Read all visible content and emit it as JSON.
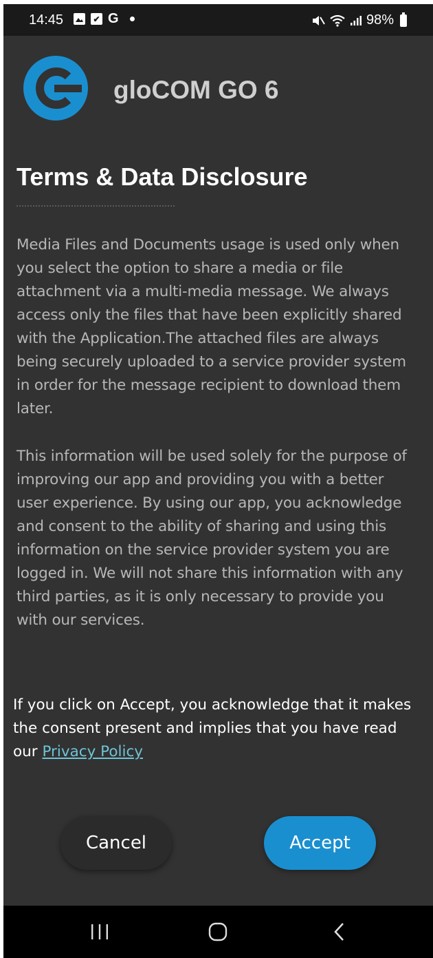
{
  "status_bar": {
    "time": "14:45",
    "battery": "98%",
    "icons_left": [
      "gallery-icon",
      "check-mail-icon",
      "google-icon",
      "dot-icon"
    ],
    "icons_right": [
      "mute-icon",
      "wifi-icon",
      "signal-icon",
      "battery-icon"
    ]
  },
  "header": {
    "app_name": "gloCOM GO 6",
    "page_title": "Terms & Data Disclosure",
    "logo_color": "#1a8fd0"
  },
  "body": {
    "paragraph_1": "Media Files and Documents usage is used only when you select the option to share a media or file attachment via a multi-media message. We always access only the files that have been explicitly shared with the Application.The attached files are always being securely uploaded to a service provider system in order for the message recipient to download them later.",
    "paragraph_2": "This information will be used solely for the purpose of improving our app and providing you with a better user experience. By using our app, you acknowledge and consent to the ability of sharing and using this information on the service provider system you are logged in. We will not share this information with any third parties, as it is only necessary to provide you with our services."
  },
  "consent": {
    "text": "If you click on Accept, you acknowledge that it makes the consent present and implies that you have read our ",
    "link_label": "Privacy Policy"
  },
  "actions": {
    "cancel_label": "Cancel",
    "accept_label": "Accept"
  },
  "nav_bar": {
    "buttons": [
      "recents-icon",
      "home-icon",
      "back-icon"
    ]
  },
  "colors": {
    "background": "#323232",
    "accent": "#1a8fd0",
    "link": "#6fc3d6"
  }
}
